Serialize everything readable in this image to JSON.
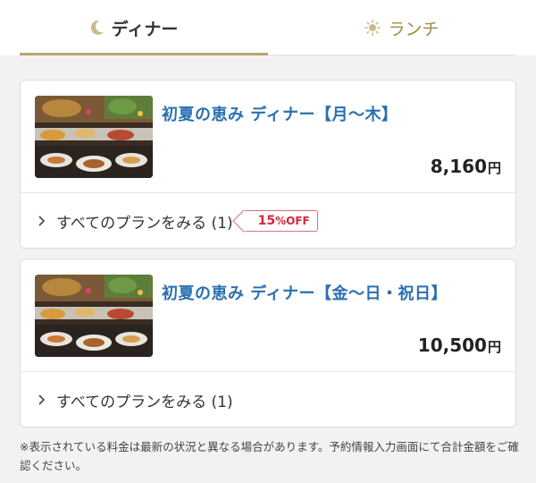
{
  "tabs": {
    "dinner": {
      "label": "ディナー",
      "icon": "moon-icon"
    },
    "lunch": {
      "label": "ランチ",
      "icon": "sun-icon"
    }
  },
  "plans": [
    {
      "title": "初夏の恵み ディナー【月〜木】",
      "price": "8,160",
      "currency": "円",
      "see_all": "すべてのプランをみる (1)",
      "badge": {
        "value": "15",
        "unit": "%OFF"
      }
    },
    {
      "title": "初夏の恵み ディナー【金〜日・祝日】",
      "price": "10,500",
      "currency": "円",
      "see_all": "すべてのプランをみる (1)"
    }
  ],
  "notice": "※表示されている料金は最新の状況と異なる場合があります。予約情報入力画面にて合計金額をご確認ください。",
  "colors": {
    "accent_gold": "#b7a771",
    "title_blue": "#2a6fb0",
    "discount_red": "#d7243c"
  }
}
